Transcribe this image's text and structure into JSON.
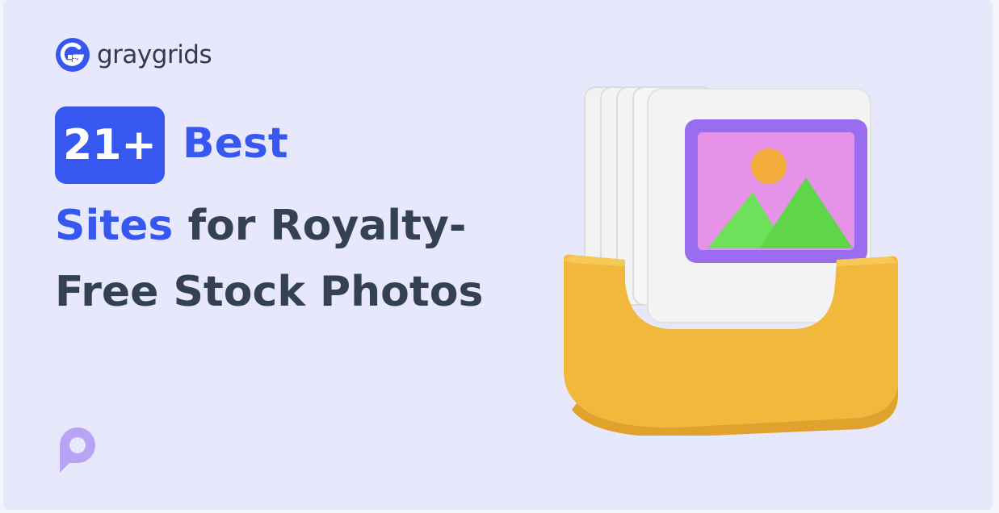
{
  "brand": {
    "name": "graygrids",
    "color": "#3758f0",
    "icon": "graygrids-logo-icon"
  },
  "headline": {
    "badge": "21+",
    "line1": "Best",
    "line2_accent": "Sites",
    "line2_rest": " for Royalty-",
    "line3": "Free Stock Photos"
  },
  "colors": {
    "background": "#e8e8fc",
    "accent": "#3758f0",
    "text": "#344054"
  },
  "illustration": {
    "icon": "photo-stack-tray-icon"
  },
  "watermark": {
    "icon": "p-logo-watermark-icon"
  }
}
